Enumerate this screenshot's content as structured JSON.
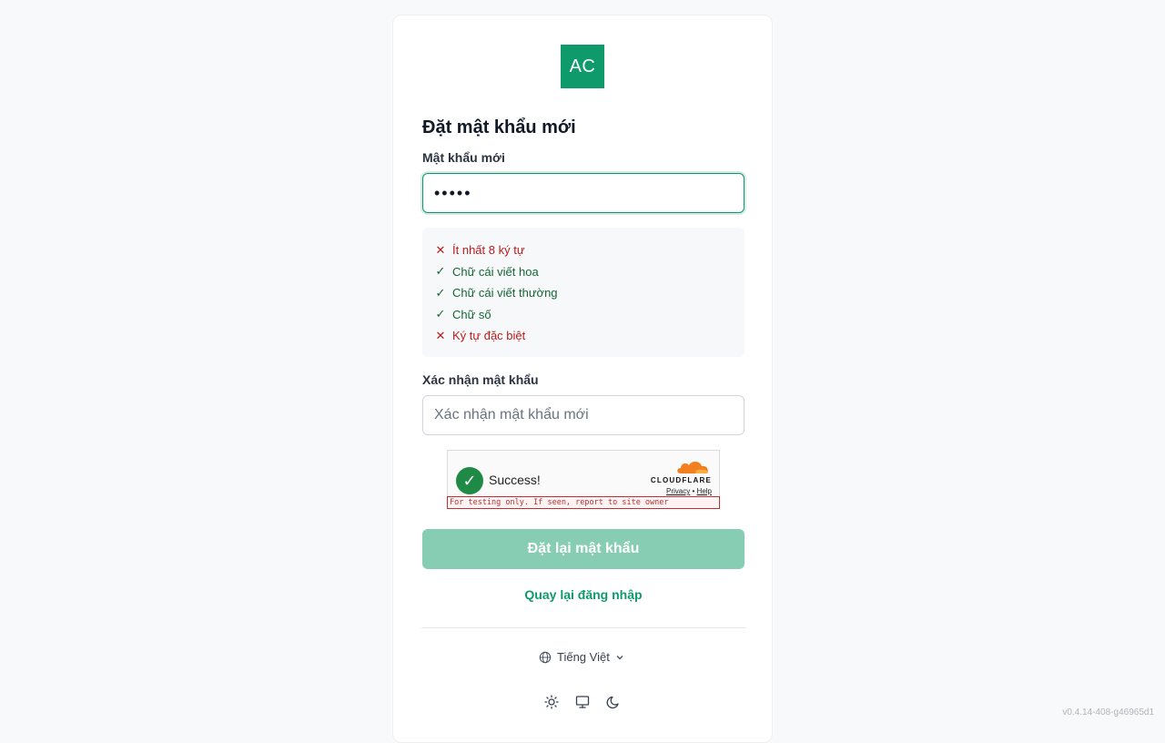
{
  "brand": {
    "logo_text": "AC",
    "logo_color": "#0f9a6b"
  },
  "form": {
    "title": "Đặt mật khẩu mới",
    "new_password_label": "Mật khẩu mới",
    "new_password_value": "•••••",
    "requirements": [
      {
        "label": "Ít nhất 8 ký tự",
        "met": false
      },
      {
        "label": "Chữ cái viết hoa",
        "met": true
      },
      {
        "label": "Chữ cái viết thường",
        "met": true
      },
      {
        "label": "Chữ số",
        "met": true
      },
      {
        "label": "Ký tự đặc biệt",
        "met": false
      }
    ],
    "confirm_label": "Xác nhận mật khẩu",
    "confirm_placeholder": "Xác nhận mật khẩu mới",
    "submit_label": "Đặt lại mật khẩu",
    "back_link": "Quay lại đăng nhập"
  },
  "captcha": {
    "status": "Success!",
    "brand": "CLOUDFLARE",
    "privacy": "Privacy",
    "separator": "•",
    "help": "Help",
    "test_notice": "For testing only. If seen, report to site owner"
  },
  "footer": {
    "language": "Tiếng Việt",
    "theme_icons": [
      "sun-icon",
      "monitor-icon",
      "moon-icon"
    ],
    "version": "v0.4.14-408-g46965d1"
  }
}
